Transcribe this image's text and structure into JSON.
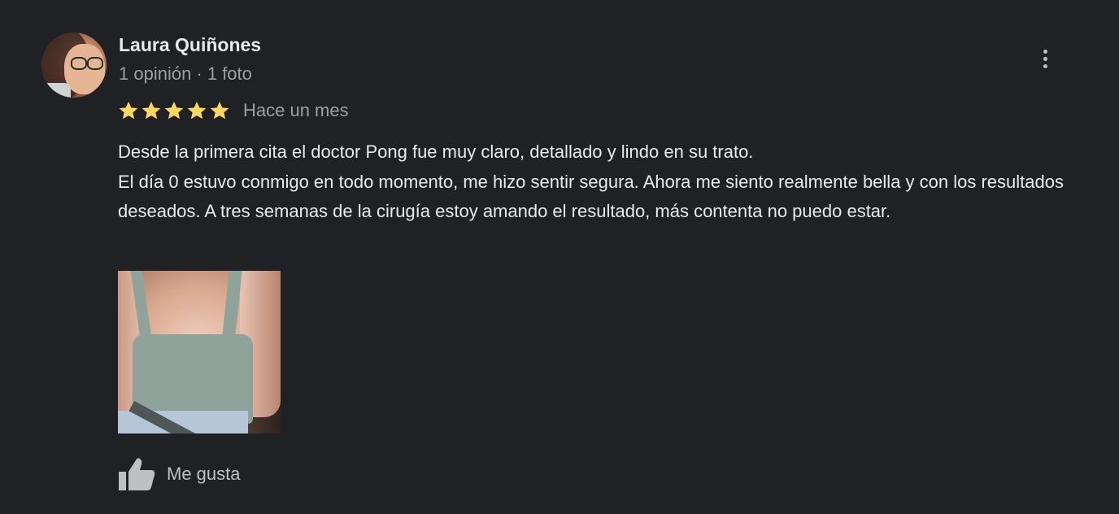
{
  "review": {
    "author": "Laura Quiñones",
    "meta": "1 opinión · 1 foto",
    "rating": 5,
    "rating_max": 5,
    "time": "Hace un mes",
    "text_lines": [
      "Desde la primera cita el doctor Pong fue muy claro, detallado y lindo en su trato.",
      "El día 0 estuvo conmigo en todo momento, me hizo sentir segura. Ahora me siento realmente bella y con los resultados deseados. A tres semanas de la cirugía estoy amando el resultado, más contenta no puedo estar."
    ],
    "like_label": "Me gusta"
  },
  "colors": {
    "background": "#202124",
    "star": "#fdd663",
    "primary_text": "#e8eaed",
    "secondary_text": "#9aa0a6",
    "icon": "#bdc1c6"
  },
  "icons": {
    "more": "more-vert-icon",
    "like": "thumb-up-icon",
    "star": "star-icon"
  }
}
